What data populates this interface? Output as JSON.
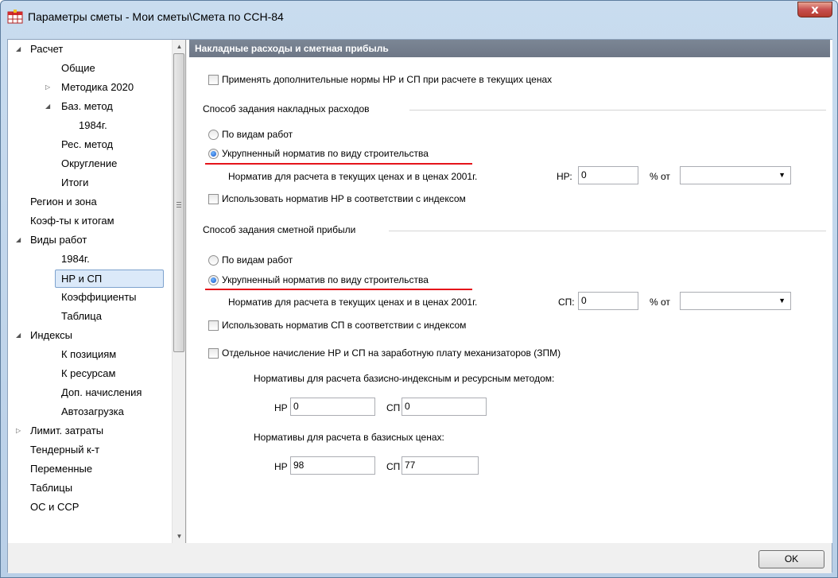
{
  "window": {
    "title": "Параметры сметы - Мои сметы\\Смета по ССН-84",
    "close_label": "x"
  },
  "sidebar": {
    "items": [
      {
        "label": "Расчет",
        "expanded": true
      },
      {
        "label": "Общие"
      },
      {
        "label": "Методика 2020",
        "collapsed": true
      },
      {
        "label": "Баз. метод",
        "expanded": true
      },
      {
        "label": "1984г."
      },
      {
        "label": "Рес. метод"
      },
      {
        "label": "Округление"
      },
      {
        "label": "Итоги"
      },
      {
        "label": "Регион и зона"
      },
      {
        "label": "Коэф-ты к итогам"
      },
      {
        "label": "Виды работ",
        "expanded": true
      },
      {
        "label": "1984г."
      },
      {
        "label": "НР и СП",
        "selected": true
      },
      {
        "label": "Коэффициенты"
      },
      {
        "label": "Таблица"
      },
      {
        "label": "Индексы",
        "expanded": true
      },
      {
        "label": "К позициям"
      },
      {
        "label": "К ресурсам"
      },
      {
        "label": "Доп. начисления"
      },
      {
        "label": "Автозагрузка"
      },
      {
        "label": "Лимит. затраты",
        "collapsed": true
      },
      {
        "label": "Тендерный к-т"
      },
      {
        "label": "Переменные"
      },
      {
        "label": "Таблицы"
      },
      {
        "label": "ОС и ССР"
      }
    ]
  },
  "main": {
    "header": "Накладные расходы и сметная прибыль",
    "apply_extra_label": "Применять дополнительные нормы НР и СП при расчете в текущих ценах",
    "overhead": {
      "group_label": "Способ задания накладных расходов",
      "option_by_type": "По видам работ",
      "option_aggregated": "Укрупненный норматив по виду строительства",
      "norm_label": "Норматив для расчета в текущих ценах и в ценах 2001г.",
      "field_label": "НР:",
      "value": "0",
      "percent_label": "% от",
      "percent_of": "",
      "use_index_label": "Использовать норматив НР в соответствии с индексом"
    },
    "profit": {
      "group_label": "Способ задания сметной прибыли",
      "option_by_type": "По видам работ",
      "option_aggregated": "Укрупненный норматив по виду строительства",
      "norm_label": "Норматив для расчета в текущих ценах и в ценах 2001г.",
      "field_label": "СП:",
      "value": "0",
      "percent_label": "% от",
      "percent_of": "",
      "use_index_label": "Использовать норматив СП в соответствии с индексом"
    },
    "separate_label": "Отдельное начисление НР и СП на заработную плату механизаторов (ЗПМ)",
    "basis_index": {
      "title": "Нормативы для расчета базисно-индексным и ресурсным методом:",
      "nr_label": "НР",
      "nr_value": "0",
      "sp_label": "СП",
      "sp_value": "0"
    },
    "basis_prices": {
      "title": "Нормативы для расчета в базисных ценах:",
      "nr_label": "НР",
      "nr_value": "98",
      "sp_label": "СП",
      "sp_value": "77"
    }
  },
  "footer": {
    "ok_label": "OK"
  },
  "colors": {
    "accent_red": "#e5141a",
    "header_bg": "#6e7786",
    "selection_bg": "#dbe9f9"
  }
}
